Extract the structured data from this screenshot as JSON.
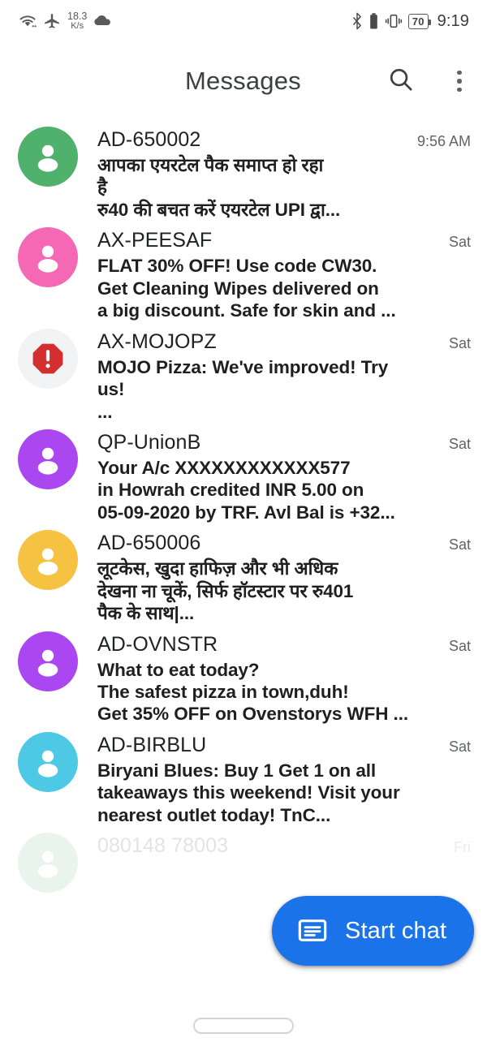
{
  "statusbar": {
    "network_speed_value": "18.3",
    "network_speed_unit": "K/s",
    "battery_level": "70",
    "time": "9:19",
    "icons": [
      "wifi-icon",
      "airplane-mode-icon",
      "cloud-icon",
      "bluetooth-icon",
      "battery-icon",
      "vibrate-icon",
      "battery-percent-icon"
    ]
  },
  "appbar": {
    "title": "Messages",
    "search_label": "search-icon",
    "menu_label": "more-options-icon"
  },
  "conversations": [
    {
      "sender": "AD-650002",
      "time": "9:56 AM",
      "preview": "आपका एयरटेल पैक समाप्त हो रहा\nहै\nरु40 की बचत करें एयरटेल UPI द्वा...",
      "avatar_color": "#4fb16b",
      "avatar_type": "person"
    },
    {
      "sender": "AX-PEESAF",
      "time": "Sat",
      "preview": "FLAT 30% OFF! Use code CW30.\nGet Cleaning Wipes delivered on\na big discount. Safe for skin and ...",
      "avatar_color": "#f569b4",
      "avatar_type": "person"
    },
    {
      "sender": "AX-MOJOPZ",
      "time": "Sat",
      "preview": "MOJO Pizza: We've improved! Try\nus!\n...",
      "avatar_color": "#d32f2f",
      "avatar_type": "spam"
    },
    {
      "sender": "QP-UnionB",
      "time": "Sat",
      "preview": "Your A/c XXXXXXXXXXXX577\nin Howrah credited INR 5.00 on\n05-09-2020 by TRF. Avl Bal is +32...",
      "avatar_color": "#ab47f0",
      "avatar_type": "person"
    },
    {
      "sender": "AD-650006",
      "time": "Sat",
      "preview": "लूटकेस, खुदा हाफिज़ और भी अधिक\nदेखना ना चूकें, सिर्फ हॉटस्टार पर रु401\nपैक के साथ|...",
      "avatar_color": "#f5c242",
      "avatar_type": "person"
    },
    {
      "sender": "AD-OVNSTR",
      "time": "Sat",
      "preview": "What to eat today?\nThe safest pizza in town,duh!\nGet 35% OFF on Ovenstorys WFH ...",
      "avatar_color": "#ab47f0",
      "avatar_type": "person"
    },
    {
      "sender": "AD-BIRBLU",
      "time": "Sat",
      "preview": "Biryani Blues: Buy 1 Get 1 on all\ntakeaways this weekend! Visit your\nnearest outlet today! TnC...",
      "avatar_color": "#4dc9e6",
      "avatar_type": "person"
    },
    {
      "sender": "080148 78003",
      "time": "Fri",
      "preview": "",
      "avatar_color": "#4fb16b",
      "avatar_type": "person"
    }
  ],
  "fab": {
    "label": "Start chat",
    "icon": "message-icon",
    "color": "#1a73e8"
  },
  "colors": {
    "accent": "#1a73e8",
    "background": "#ffffff",
    "text_primary": "#202124",
    "text_secondary": "#5f6368"
  }
}
